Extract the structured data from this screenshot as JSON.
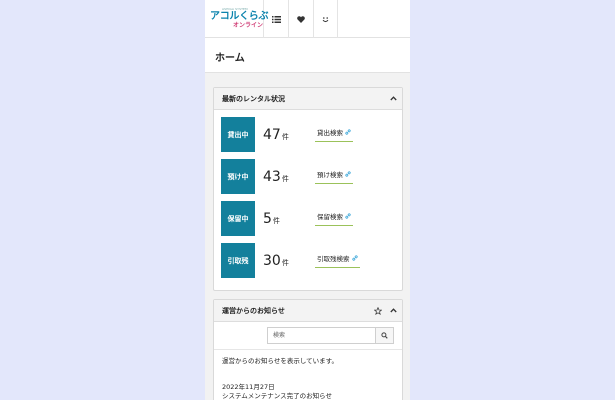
{
  "header": {
    "logo_small": "ASHIGA SYSTEM",
    "logo_main": "アコルくらぶ",
    "logo_sub": "オンライン",
    "nav_icons": [
      "list-icon",
      "heart-icon",
      "smile-icon"
    ]
  },
  "page": {
    "title": "ホーム"
  },
  "rental_panel": {
    "title": "最新のレンタル状況",
    "collapse_icon": "chevron-up-icon",
    "rows": [
      {
        "label": "貸出中",
        "count": "47",
        "unit": "件",
        "link": "貸出検索"
      },
      {
        "label": "預け中",
        "count": "43",
        "unit": "件",
        "link": "預け検索"
      },
      {
        "label": "保留中",
        "count": "5",
        "unit": "件",
        "link": "保留検索"
      },
      {
        "label": "引取残",
        "count": "30",
        "unit": "件",
        "link": "引取残検索"
      }
    ]
  },
  "notice_panel": {
    "title": "運営からのお知らせ",
    "star_icon": "star-icon",
    "collapse_icon": "chevron-up-icon",
    "search_placeholder": "検索",
    "search_icon": "search-icon",
    "description": "運営からのお知らせを表示しています。",
    "date": "2022年11月27日",
    "item_title": "システムメンテナンス完了のお知らせ"
  },
  "colors": {
    "badge": "#13809c",
    "link_underline": "#9bc25a",
    "background": "#e3e7fb",
    "logo_blue": "#0b83ad",
    "logo_pink": "#d2457b"
  }
}
